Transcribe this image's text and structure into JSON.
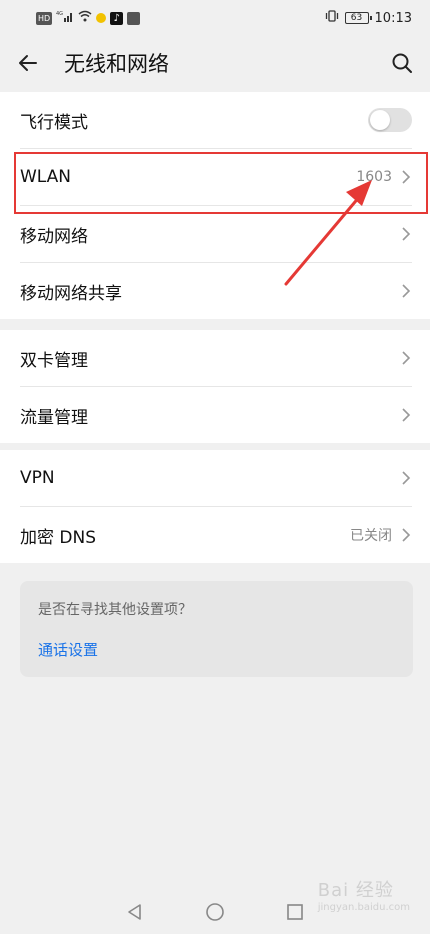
{
  "status_bar": {
    "left_icons": [
      "HD",
      "4G",
      "wifi",
      "app",
      "tiktok",
      "app2"
    ],
    "time": "10:13",
    "battery": "63"
  },
  "header": {
    "title": "无线和网络",
    "back_icon": "arrow-left-icon",
    "search_icon": "search-icon"
  },
  "group1": {
    "airplane_label": "飞行模式",
    "airplane_on": false,
    "wlan_label": "WLAN",
    "wlan_value": "1603",
    "mobile_network_label": "移动网络",
    "hotspot_label": "移动网络共享"
  },
  "group2": {
    "dual_sim_label": "双卡管理",
    "data_usage_label": "流量管理"
  },
  "group3": {
    "vpn_label": "VPN",
    "dns_label": "加密 DNS",
    "dns_value": "已关闭"
  },
  "suggestion": {
    "question": "是否在寻找其他设置项？",
    "link": "通话设置"
  },
  "annotation": {
    "color": "#e53935"
  },
  "watermark": {
    "text": "Bai 经验",
    "sub": "jingyan.baidu.com"
  },
  "colors": {
    "background": "#f0f0f0",
    "card": "#ffffff",
    "link": "#1a73e8"
  }
}
